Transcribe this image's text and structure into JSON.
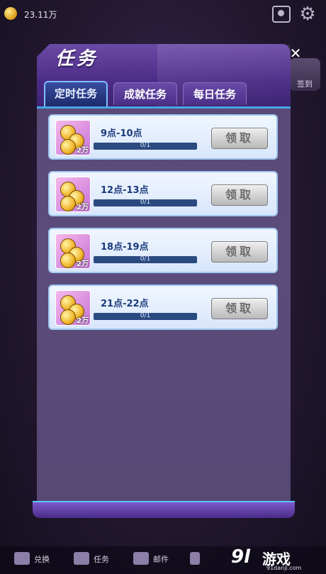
{
  "topbar": {
    "coins": "23.11万"
  },
  "side": {
    "label": "签到"
  },
  "panel": {
    "title": "任务",
    "close_icon": "✕",
    "tabs": [
      {
        "label": "定时任务",
        "active": true
      },
      {
        "label": "成就任务",
        "active": false
      },
      {
        "label": "每日任务",
        "active": false
      }
    ]
  },
  "tasks": [
    {
      "title": "9点-10点",
      "progress_text": "0/1",
      "progress": 0,
      "reward": "2万",
      "button": "领取"
    },
    {
      "title": "12点-13点",
      "progress_text": "0/1",
      "progress": 0,
      "reward": "2万",
      "button": "领取"
    },
    {
      "title": "18点-19点",
      "progress_text": "0/1",
      "progress": 0,
      "reward": "2万",
      "button": "领取"
    },
    {
      "title": "21点-22点",
      "progress_text": "0/1",
      "progress": 0,
      "reward": "2万",
      "button": "领取"
    }
  ],
  "bottom_nav": [
    {
      "label": "兑换",
      "icon": "exchange-icon"
    },
    {
      "label": "任务",
      "icon": "task-icon"
    },
    {
      "label": "邮件",
      "icon": "mail-icon"
    }
  ],
  "watermark": {
    "logo": "9l",
    "brand": "游戏",
    "url": "91danji.com"
  },
  "colors": {
    "accent": "#4aa6e6",
    "panel": "#5a4a78",
    "header": "#4b2c86"
  }
}
